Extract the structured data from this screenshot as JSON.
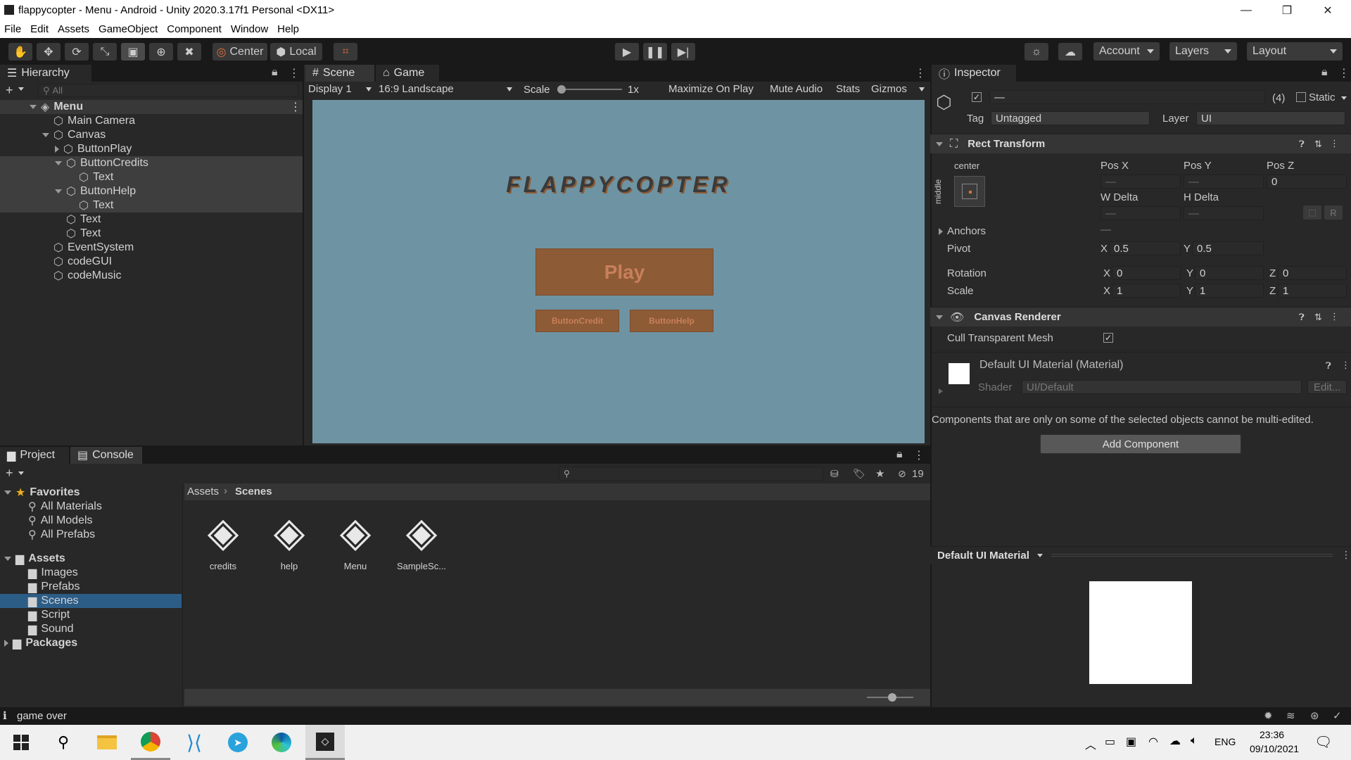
{
  "window": {
    "title": "flappycopter - Menu - Android - Unity 2020.3.17f1 Personal <DX11>",
    "minimize": "—",
    "maximize": "❐",
    "close": "✕"
  },
  "menu": [
    "File",
    "Edit",
    "Assets",
    "GameObject",
    "Component",
    "Window",
    "Help"
  ],
  "toolbar": {
    "pivot": "Center",
    "space": "Local",
    "account": "Account",
    "layers": "Layers",
    "layout": "Layout"
  },
  "hierarchy": {
    "tab": "Hierarchy",
    "search_placeholder": "All",
    "add": "+",
    "items": [
      {
        "label": "Menu",
        "depth": 0,
        "fold": "down",
        "scene": true,
        "sel": false
      },
      {
        "label": "Main Camera",
        "depth": 1,
        "fold": "",
        "sel": false
      },
      {
        "label": "Canvas",
        "depth": 1,
        "fold": "down",
        "sel": false
      },
      {
        "label": "ButtonPlay",
        "depth": 2,
        "fold": "right",
        "sel": false
      },
      {
        "label": "ButtonCredits",
        "depth": 2,
        "fold": "down",
        "sel": true
      },
      {
        "label": "Text",
        "depth": 3,
        "fold": "",
        "sel": true
      },
      {
        "label": "ButtonHelp",
        "depth": 2,
        "fold": "down",
        "sel": true
      },
      {
        "label": "Text",
        "depth": 3,
        "fold": "",
        "sel": true
      },
      {
        "label": "Text",
        "depth": 2,
        "fold": "",
        "sel": false
      },
      {
        "label": "Text",
        "depth": 2,
        "fold": "",
        "sel": false
      },
      {
        "label": "EventSystem",
        "depth": 1,
        "fold": "",
        "sel": false
      },
      {
        "label": "codeGUI",
        "depth": 1,
        "fold": "",
        "sel": false
      },
      {
        "label": "codeMusic",
        "depth": 1,
        "fold": "",
        "sel": false
      }
    ]
  },
  "game": {
    "tab_scene": "Scene",
    "tab_game": "Game",
    "display": "Display 1",
    "aspect": "16:9 Landscape",
    "scale_label": "Scale",
    "scale_value": "1x",
    "options": [
      "Maximize On Play",
      "Mute Audio",
      "Stats",
      "Gizmos"
    ],
    "title": "FLAPPYCOPTER",
    "play": "Play",
    "credit": "ButtonCredit",
    "help": "ButtonHelp",
    "colors": {
      "bg": "#6e94a3",
      "button": "#8d5b36",
      "button_text": "#c8805a",
      "title": "#3a3a3a"
    }
  },
  "inspector": {
    "tab": "Inspector",
    "name_value": "—",
    "count": "(4)",
    "static": "Static",
    "tag_label": "Tag",
    "tag": "Untagged",
    "layer_label": "Layer",
    "layer": "UI",
    "rect": {
      "title": "Rect Transform",
      "anchor_h": "center",
      "anchor_v": "middle",
      "posx": "Pos X",
      "posy": "Pos Y",
      "posz": "Pos Z",
      "posx_v": "—",
      "posy_v": "—",
      "posz_v": "0",
      "wdelta": "W Delta",
      "hdelta": "H Delta",
      "w_v": "—",
      "h_v": "—",
      "r_btn": "R",
      "anchors": "Anchors",
      "anchors_v": "—",
      "pivot": "Pivot",
      "pivot_x": "0.5",
      "pivot_y": "0.5",
      "rotation": "Rotation",
      "rot_x": "0",
      "rot_y": "0",
      "rot_z": "0",
      "scale": "Scale",
      "scale_x": "1",
      "scale_y": "1",
      "scale_z": "1",
      "x": "X",
      "y": "Y",
      "z": "Z"
    },
    "canvas_renderer": {
      "title": "Canvas Renderer",
      "cull": "Cull Transparent Mesh"
    },
    "material": {
      "title": "Default UI Material (Material)",
      "shader_label": "Shader",
      "shader": "UI/Default",
      "edit": "Edit..."
    },
    "note": "Components that are only on some of the selected objects cannot be multi-edited.",
    "add_component": "Add Component",
    "preview_title": "Default UI Material"
  },
  "project": {
    "tab_project": "Project",
    "tab_console": "Console",
    "add": "+",
    "count": "19",
    "favorites": "Favorites",
    "fav_items": [
      "All Materials",
      "All Models",
      "All Prefabs"
    ],
    "assets": "Assets",
    "folders": [
      "Images",
      "Prefabs",
      "Scenes",
      "Script",
      "Sound"
    ],
    "packages": "Packages",
    "breadcrumb_root": "Assets",
    "breadcrumb_current": "Scenes",
    "files": [
      "credits",
      "help",
      "Menu",
      "SampleSc..."
    ]
  },
  "status": {
    "message": "game over"
  },
  "taskbar": {
    "lang": "ENG",
    "time": "23:36",
    "date": "09/10/2021"
  }
}
